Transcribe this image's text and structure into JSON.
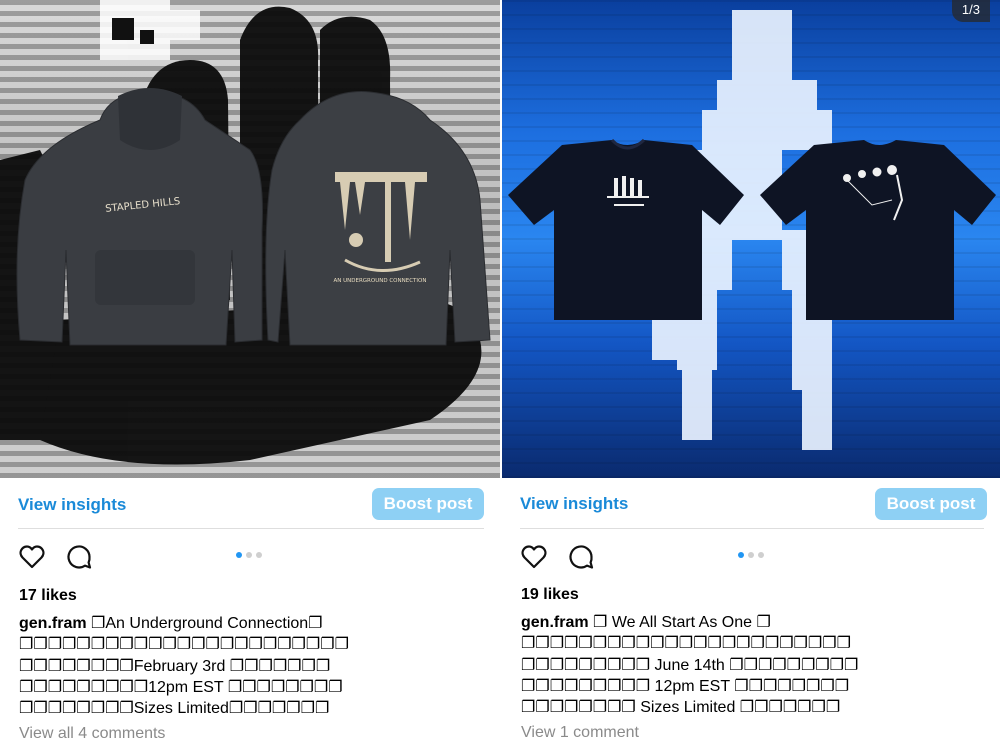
{
  "posts": [
    {
      "insights": "View insights",
      "boost": "Boost post",
      "likes": "17 likes",
      "username": "gen.fram",
      "caption_lines": [
        "❐An Underground Connection❐",
        "❐❐❐❐❐❐❐❐❐❐❐❐❐❐❐❐❐❐❐❐❐❐❐",
        "❐❐❐❐❐❐❐❐February 3rd ❐❐❐❐❐❐❐",
        "❐❐❐❐❐❐❐❐❐12pm EST ❐❐❐❐❐❐❐❐",
        "❐❐❐❐❐❐❐❐Sizes Limited❐❐❐❐❐❐❐"
      ],
      "comments": "View all 4 comments",
      "media_text": {
        "front_print": "STAPLED HILLS",
        "back_print": "AN UNDERGROUND CONNECTION"
      }
    },
    {
      "counter": "1/3",
      "insights": "View insights",
      "boost": "Boost post",
      "likes": "19 likes",
      "username": "gen.fram",
      "caption_lines": [
        "❐ We All Start As One ❐",
        "❐❐❐❐❐❐❐❐❐❐❐❐❐❐❐❐❐❐❐❐❐❐❐",
        "❐❐❐❐❐❐❐❐❐ June 14th ❐❐❐❐❐❐❐❐❐",
        "❐❐❐❐❐❐❐❐❐ 12pm EST ❐❐❐❐❐❐❐❐",
        "❐❐❐❐❐❐❐❐ Sizes Limited ❐❐❐❐❐❐❐"
      ],
      "comments": "View 1 comment"
    }
  ],
  "colors": {
    "link": "#1a8ad8",
    "boost_bg": "#8ed0f4",
    "dot_active": "#2196f3",
    "dot_inactive": "#cfcfcf",
    "muted": "#8a8a8a"
  },
  "carousel": {
    "slides": 3,
    "active_index": 0
  }
}
